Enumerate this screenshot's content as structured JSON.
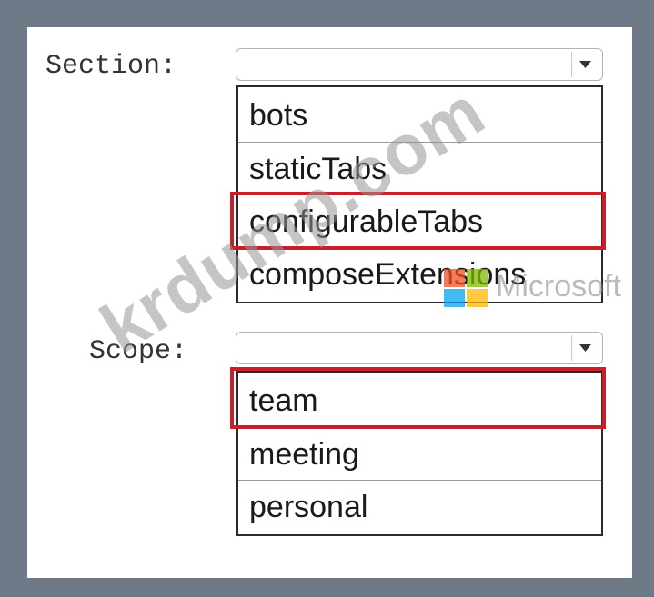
{
  "section": {
    "label": "Section:",
    "selected_value": "",
    "options": [
      {
        "label": "bots",
        "highlighted": false
      },
      {
        "label": "staticTabs",
        "highlighted": false
      },
      {
        "label": "configurableTabs",
        "highlighted": true
      },
      {
        "label": "composeExtensions",
        "highlighted": false
      }
    ]
  },
  "scope": {
    "label": "Scope:",
    "selected_value": "",
    "options": [
      {
        "label": "team",
        "highlighted": true
      },
      {
        "label": "meeting",
        "highlighted": false
      },
      {
        "label": "personal",
        "highlighted": false
      }
    ]
  },
  "watermark": {
    "site": "krdump.com",
    "brand": "Microsoft"
  },
  "colors": {
    "background": "#6f7a88",
    "panel": "#ffffff",
    "highlight": "#c8202a",
    "list_border": "#2a2a2a",
    "ms_red": "#f25022",
    "ms_green": "#7fba00",
    "ms_blue": "#00a4ef",
    "ms_yellow": "#ffb900"
  },
  "icons": {
    "dropdown": "chevron-down-icon",
    "brand_logo": "microsoft-logo-icon"
  }
}
